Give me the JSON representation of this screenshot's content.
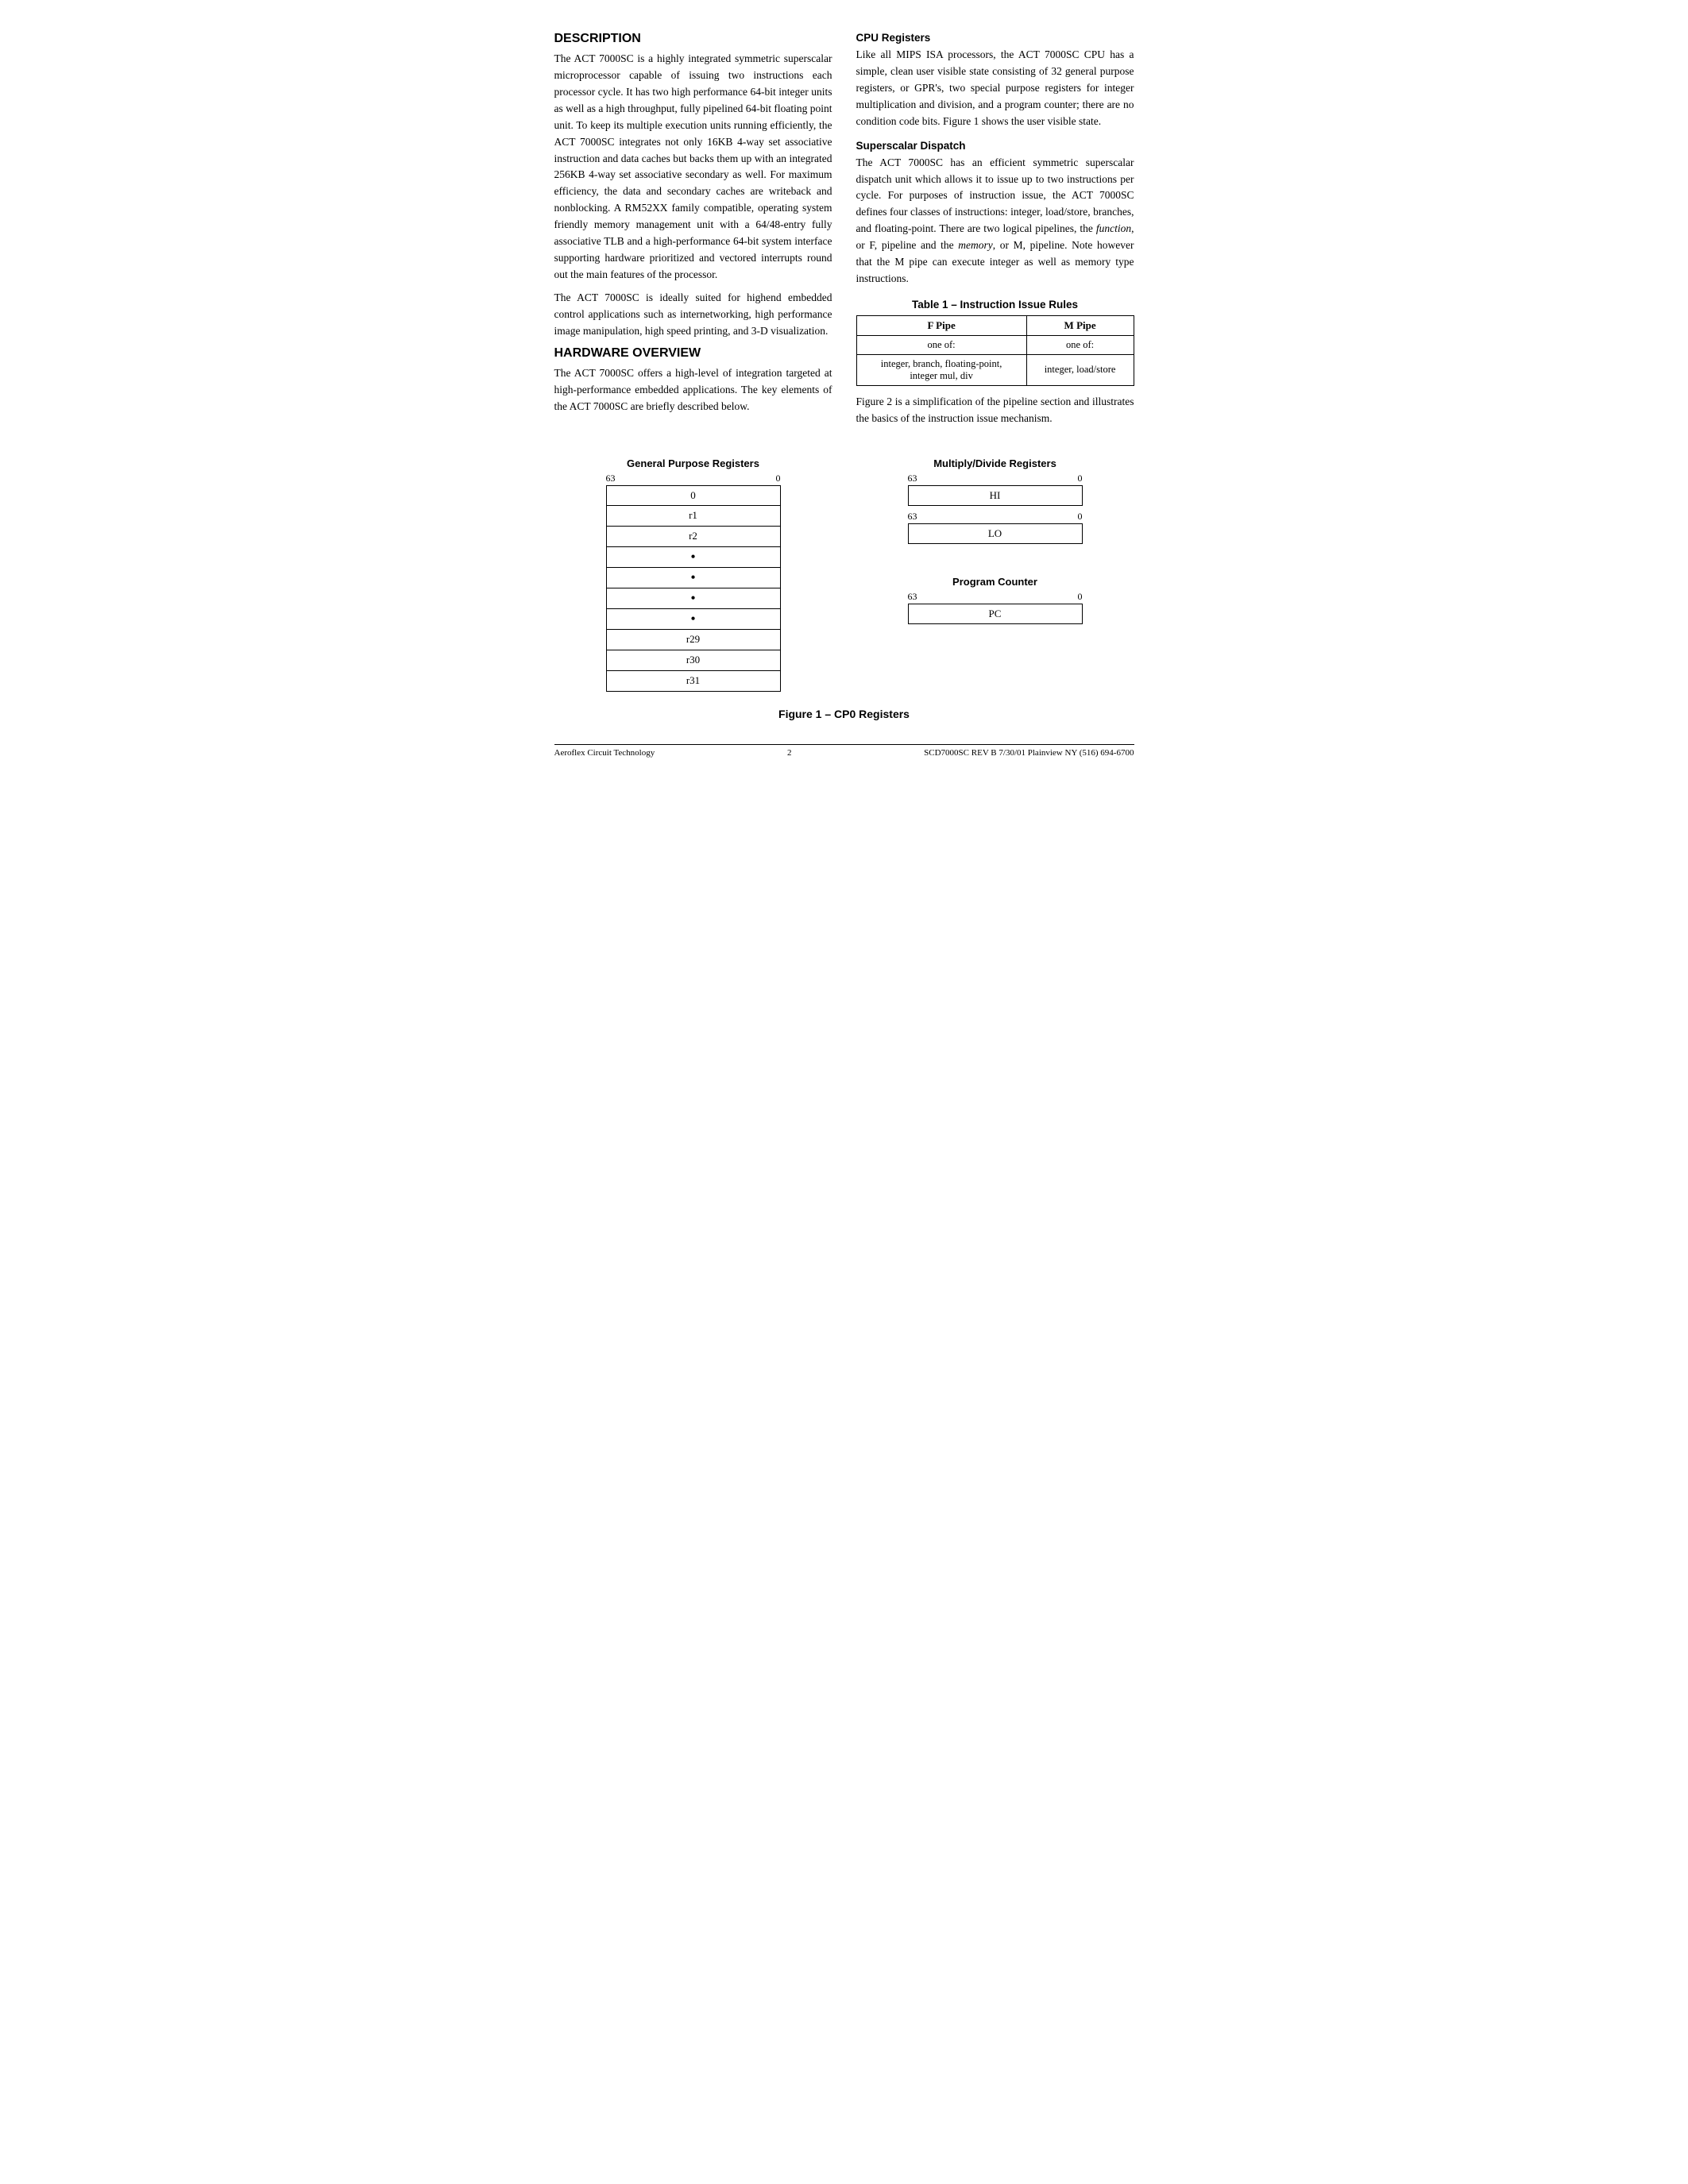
{
  "page": {
    "left_col": {
      "description_title": "DESCRIPTION",
      "description_p1": "The ACT 7000SC is a highly integrated symmetric superscalar microprocessor capable of issuing two instructions each processor cycle. It has two high performance 64-bit integer units as well as a high throughput, fully pipelined 64-bit floating point unit. To keep its multiple execution units running efficiently, the ACT 7000SC integrates not only 16KB 4-way set associative instruction and data caches but backs them up with an integrated 256KB 4-way set associative secondary as well. For maximum efficiency, the data and secondary caches are writeback and nonblocking. A RM52XX family compatible, operating system friendly memory management unit with a 64/48-entry fully associative TLB and a high-performance 64-bit system interface supporting hardware prioritized and vectored interrupts round out the main features of the processor.",
      "description_p2": "The ACT 7000SC is ideally suited for highend embedded control applications such as internetworking, high performance image manipulation, high speed printing, and 3-D visualization.",
      "hardware_title": "HARDWARE OVERVIEW",
      "hardware_p1": "The ACT 7000SC offers a high-level of integration targeted at high-performance embedded applications. The key elements of the ACT 7000SC are briefly described below."
    },
    "right_col": {
      "cpu_title": "CPU Registers",
      "cpu_p1": "Like all MIPS ISA processors, the ACT 7000SC CPU has a simple, clean user visible state consisting of 32 general purpose registers, or GPR's, two special purpose registers for integer multiplication and division, and a program counter; there are no condition code bits. Figure 1 shows the user visible state.",
      "superscalar_title": "Superscalar Dispatch",
      "superscalar_p1": "The ACT 7000SC has an efficient symmetric superscalar dispatch unit which allows it to issue up to two instructions per cycle. For purposes of instruction issue, the ACT 7000SC defines four classes of instructions: integer, load/store, branches, and floating-point. There are two logical pipelines, the function, or F, pipeline and the memory, or M, pipeline. Note however that the M pipe can execute integer as well as memory type instructions.",
      "table_title": "Table 1 – Instruction Issue Rules",
      "table_headers": [
        "F Pipe",
        "M Pipe"
      ],
      "table_row1": [
        "one of:",
        "one of:"
      ],
      "table_row2": [
        "integer, branch, floating-point, integer mul, div",
        "integer, load/store"
      ],
      "figure_note": "Figure 2 is a simplification of the pipeline section and illustrates the basics of the instruction issue mechanism."
    }
  },
  "figure": {
    "gpr_title": "General Purpose Registers",
    "gpr_bit_left": "63",
    "gpr_bit_right": "0",
    "gpr_rows": [
      "0",
      "r1",
      "r2",
      "•",
      "•",
      "•",
      "•",
      "r29",
      "r30",
      "r31"
    ],
    "md_title": "Multiply/Divide Registers",
    "md_bit_left": "63",
    "md_bit_right": "0",
    "md_HI": "HI",
    "md_LO_bit_left": "63",
    "md_LO_bit_right": "0",
    "md_LO": "LO",
    "pc_title": "Program Counter",
    "pc_bit_left": "63",
    "pc_bit_right": "0",
    "pc_label": "PC",
    "caption": "Figure 1 – CP0 Registers"
  },
  "footer": {
    "left": "Aeroflex Circuit Technology",
    "center": "2",
    "right": "SCD7000SC REV B  7/30/01  Plainview NY (516) 694-6700"
  }
}
